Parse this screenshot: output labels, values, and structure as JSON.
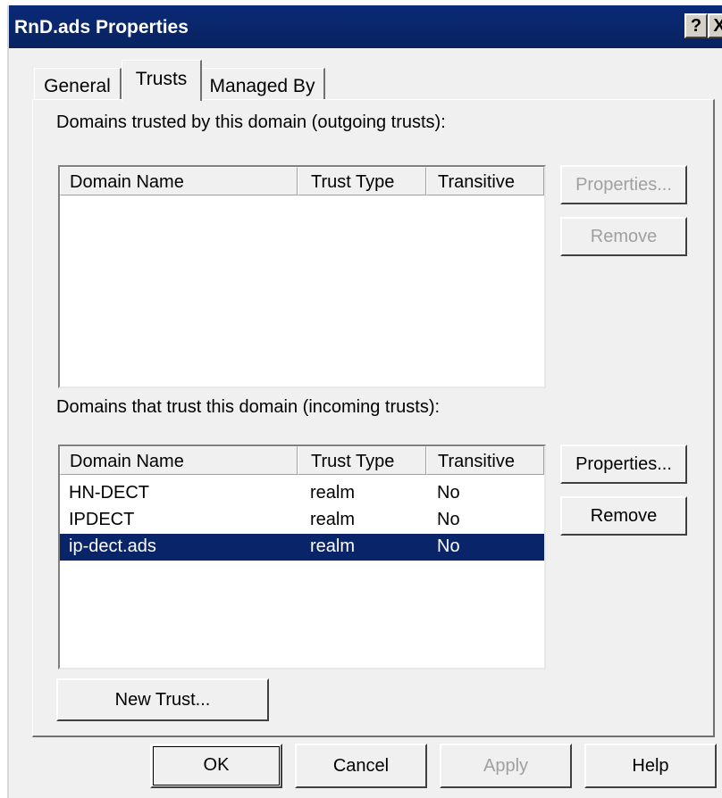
{
  "window": {
    "title": "RnD.ads Properties",
    "help_button": "?",
    "close_button": "X"
  },
  "tabs": [
    {
      "label": "General"
    },
    {
      "label": "Trusts",
      "active": true
    },
    {
      "label": "Managed By"
    }
  ],
  "outgoing": {
    "label": "Domains trusted by this domain (outgoing trusts):",
    "columns": [
      "Domain Name",
      "Trust Type",
      "Transitive"
    ],
    "rows": [],
    "properties_button": "Properties...",
    "remove_button": "Remove"
  },
  "incoming": {
    "label": "Domains that trust this domain (incoming trusts):",
    "columns": [
      "Domain Name",
      "Trust Type",
      "Transitive"
    ],
    "rows": [
      {
        "name": "HN-DECT",
        "type": "realm",
        "transitive": "No"
      },
      {
        "name": "IPDECT",
        "type": "realm",
        "transitive": "No"
      },
      {
        "name": "ip-dect.ads",
        "type": "realm",
        "transitive": "No",
        "selected": true
      }
    ],
    "properties_button": "Properties...",
    "remove_button": "Remove"
  },
  "new_trust_button": "New Trust...",
  "footer": {
    "ok": "OK",
    "cancel": "Cancel",
    "apply": "Apply",
    "help": "Help"
  },
  "colors": {
    "titlebar": "#0a246a",
    "selection": "#0a246a",
    "face": "#f0f0f0"
  }
}
